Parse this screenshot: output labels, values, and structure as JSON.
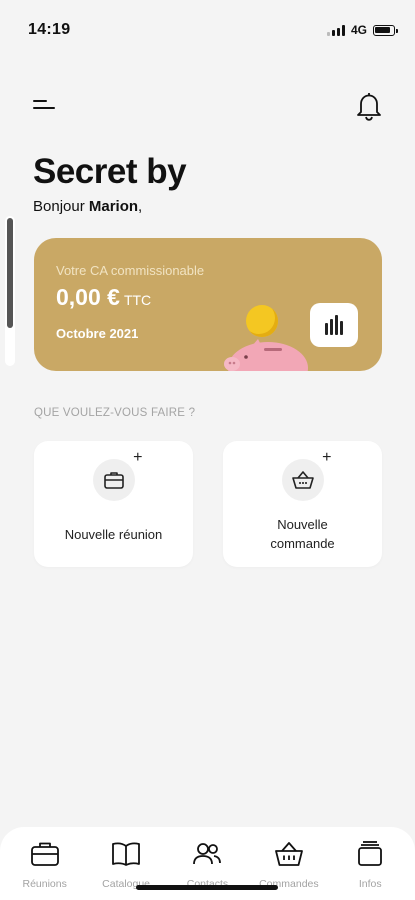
{
  "status_bar": {
    "time": "14:19",
    "network": "4G"
  },
  "header": {
    "brand_title": "Secret by",
    "greeting_prefix": "Bonjour",
    "user_name": "Marion",
    "greeting_suffix": ","
  },
  "revenue_card": {
    "label": "Votre CA commissionable",
    "amount": "0,00 €",
    "unit": "TTC",
    "period": "Octobre 2021",
    "colors": {
      "card": "#c9a865",
      "coin": "#f4c722",
      "piggy": "#f2a7b6"
    }
  },
  "actions": {
    "section_title": "QUE VOULEZ-VOUS FAIRE ?",
    "items": [
      {
        "label": "Nouvelle réunion",
        "icon": "briefcase-plus-icon"
      },
      {
        "label": "Nouvelle commande",
        "icon": "basket-plus-icon"
      }
    ]
  },
  "bottom_nav": {
    "items": [
      {
        "label": "Réunions",
        "icon": "briefcase-icon"
      },
      {
        "label": "Catalogue",
        "icon": "book-icon"
      },
      {
        "label": "Contacts",
        "icon": "people-icon"
      },
      {
        "label": "Commandes",
        "icon": "basket-icon"
      },
      {
        "label": "Infos",
        "icon": "stack-icon"
      }
    ]
  }
}
